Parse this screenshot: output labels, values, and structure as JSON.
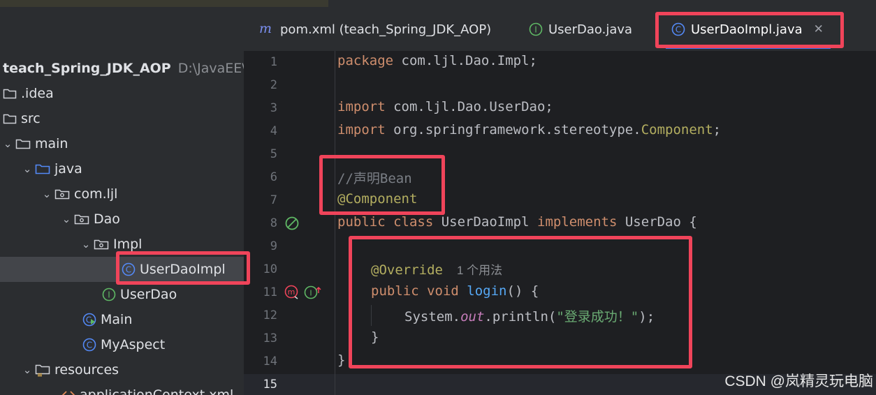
{
  "project": {
    "root_name": "teach_Spring_JDK_AOP",
    "root_path": "D:\\JavaEE\\teach",
    "tree": [
      {
        "label": ".idea",
        "icon": "folder-icon"
      },
      {
        "label": "src",
        "icon": "folder-icon"
      },
      {
        "label": "main",
        "icon": "folder-icon"
      },
      {
        "label": "java",
        "icon": "source-folder-icon"
      },
      {
        "label": "com.ljl",
        "icon": "package-icon"
      },
      {
        "label": "Dao",
        "icon": "package-icon"
      },
      {
        "label": "Impl",
        "icon": "package-icon"
      },
      {
        "label": "UserDaoImpl",
        "icon": "class-icon"
      },
      {
        "label": "UserDao",
        "icon": "interface-icon"
      },
      {
        "label": "Main",
        "icon": "runnable-class-icon"
      },
      {
        "label": "MyAspect",
        "icon": "class-icon"
      },
      {
        "label": "resources",
        "icon": "resources-folder-icon"
      },
      {
        "label": "applicationContext.xml",
        "icon": "xml-file-icon"
      }
    ]
  },
  "tabs": [
    {
      "label": "pom.xml (teach_Spring_JDK_AOP)",
      "icon": "maven-icon"
    },
    {
      "label": "UserDao.java",
      "icon": "interface-icon"
    },
    {
      "label": "UserDaoImpl.java",
      "icon": "class-icon",
      "active": true
    }
  ],
  "editor": {
    "line_numbers": [
      "1",
      "2",
      "3",
      "4",
      "5",
      "6",
      "7",
      "8",
      "9",
      "10",
      "11",
      "12",
      "13",
      "14",
      "15"
    ],
    "lines": {
      "l1_kw": "package",
      "l1_rest": " com.ljl.Dao.Impl;",
      "l3_kw": "import",
      "l3_rest": " com.ljl.Dao.UserDao;",
      "l4_kw": "import",
      "l4_rest": " org.springframework.stereotype.",
      "l4_cls": "Component",
      "l4_end": ";",
      "l6": "//声明Bean",
      "l7": "@Component",
      "l8_kw1": "public class",
      "l8_name": " UserDaoImpl ",
      "l8_kw2": "implements",
      "l8_rest": " UserDao {",
      "l10_ann": "@Override",
      "l10_hint": "1 个用法",
      "l11_kw": "public void",
      "l11_fn": "login",
      "l11_rest": "() {",
      "l12_a": "System.",
      "l12_field": "out",
      "l12_b": ".println(",
      "l12_str": "\"登录成功！\"",
      "l12_c": ");",
      "l13": "}",
      "l14": "}"
    }
  },
  "watermark": "CSDN @岚精灵玩电脑",
  "colors": {
    "highlight": "#f0445a",
    "keyword": "#cf8e6d",
    "annotation": "#b3ae60",
    "function": "#56a8f5",
    "string": "#6aab73"
  }
}
